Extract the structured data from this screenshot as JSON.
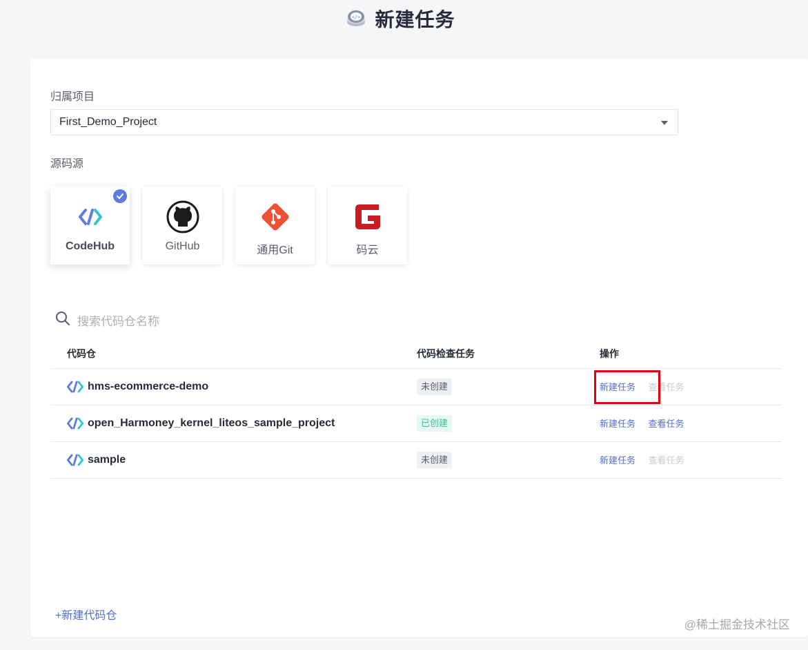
{
  "header": {
    "title": "新建任务",
    "logo_icon": "code-disk-icon"
  },
  "form": {
    "project_label": "归属项目",
    "project_value": "First_Demo_Project",
    "source_label": "源码源"
  },
  "sources": [
    {
      "name": "CodeHub",
      "icon": "codehub-icon",
      "selected": true
    },
    {
      "name": "GitHub",
      "icon": "github-icon",
      "selected": false
    },
    {
      "name": "通用Git",
      "icon": "git-icon",
      "selected": false
    },
    {
      "name": "码云",
      "icon": "gitee-icon",
      "selected": false
    }
  ],
  "search": {
    "placeholder": "搜索代码仓名称"
  },
  "table": {
    "headers": [
      "代码仓",
      "代码检查任务",
      "操作"
    ],
    "rows": [
      {
        "repo": "hms-ecommerce-demo",
        "status": "未创建",
        "status_type": "none",
        "new_task": "新建任务",
        "view_task": "查看任务",
        "view_enabled": false
      },
      {
        "repo": "open_Harmoney_kernel_liteos_sample_project",
        "status": "已创建",
        "status_type": "done",
        "new_task": "新建任务",
        "view_task": "查看任务",
        "view_enabled": true
      },
      {
        "repo": "sample",
        "status": "未创建",
        "status_type": "none",
        "new_task": "新建任务",
        "view_task": "查看任务",
        "view_enabled": false
      }
    ]
  },
  "footer": {
    "new_repo": "+新建代码仓"
  },
  "watermark": "@稀土掘金技术社区",
  "colors": {
    "accent": "#5e7ce0",
    "link": "#526ecc",
    "success": "#3ac295",
    "highlight": "#e60012"
  }
}
